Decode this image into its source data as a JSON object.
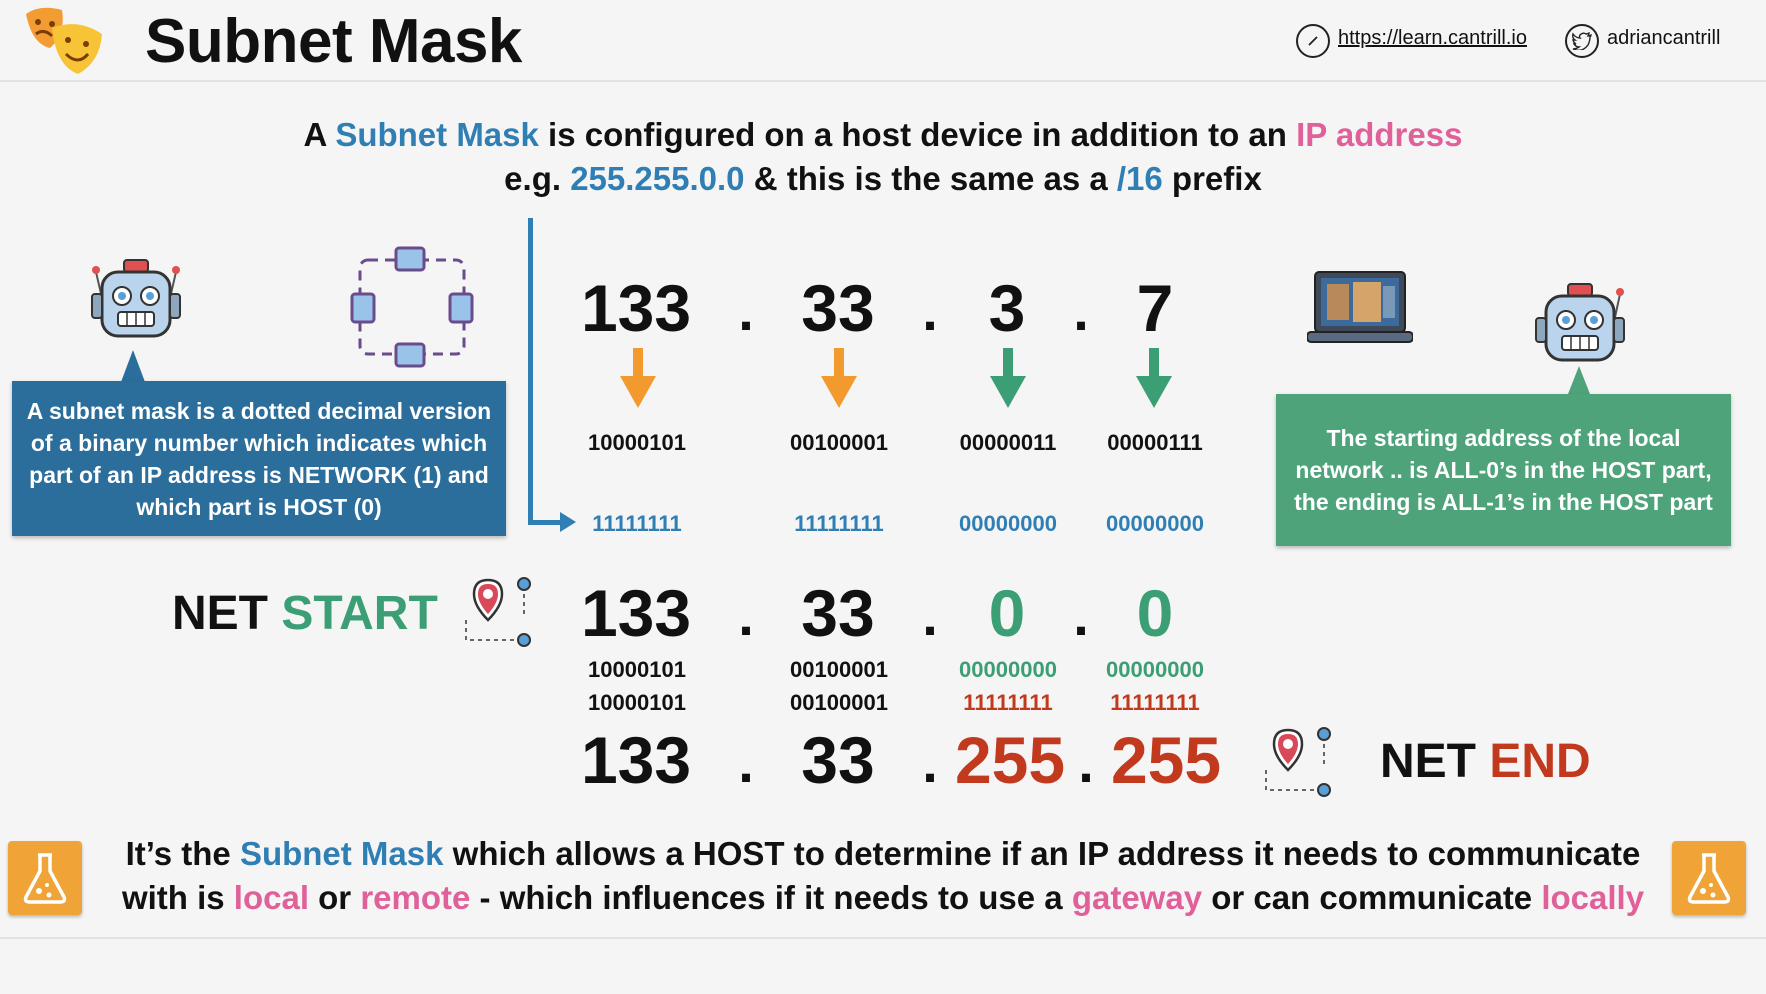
{
  "header": {
    "title": "Subnet Mask",
    "site_link": "https://learn.cantrill.io",
    "twitter_handle": "adriancantrill"
  },
  "headline": {
    "line1": {
      "p1": "A ",
      "p2": "Subnet Mask",
      "p3": " is configured on a host device in addition to an ",
      "p4": "IP address"
    },
    "line2": {
      "p1": "e.g. ",
      "p2": "255.255.0.0",
      "p3": " & this is the same as a ",
      "p4": "/16",
      "p5": " prefix"
    }
  },
  "left_callout": "A subnet mask is a dotted decimal version of a binary number which indicates which part of an IP address is NETWORK (1) and which part is HOST (0)",
  "right_callout": "The starting address of the local network .. is ALL-0’s in the HOST part, the ending is ALL-1’s in the HOST part",
  "ip": {
    "octets": [
      "133",
      "33",
      "3",
      "7"
    ],
    "binary": [
      "10000101",
      "00100001",
      "00000011",
      "00000111"
    ],
    "mask_binary": [
      "11111111",
      "11111111",
      "00000000",
      "00000000"
    ]
  },
  "net_start": {
    "label_a": "NET ",
    "label_b": "START",
    "octets": [
      "133",
      "33",
      "0",
      "0"
    ],
    "binary": [
      "10000101",
      "00100001",
      "00000000",
      "00000000"
    ]
  },
  "net_end": {
    "label_a": "NET ",
    "label_b": "END",
    "octets": [
      "133",
      "33",
      "255",
      "255"
    ],
    "binary": [
      "10000101",
      "00100001",
      "11111111",
      "11111111"
    ]
  },
  "dot": ".",
  "bottom": {
    "l1a": "It’s the ",
    "l1b": "Subnet Mask",
    "l1c": " which allows a HOST to determine if an IP address it needs to communicate",
    "l2a": "with is ",
    "l2b": "local",
    "l2c": " or ",
    "l2d": "remote",
    "l2e": " - which influences if it needs to use a ",
    "l2f": "gateway",
    "l2g": " or can communicate ",
    "l2h": "locally"
  },
  "colors": {
    "blue": "#2f7eb4",
    "pink": "#e0609a",
    "green": "#3c9e74",
    "red": "#c23a1e",
    "orange": "#f29a2e",
    "left_callout_bg": "#2b6e9c",
    "right_callout_bg": "#4fa37a"
  },
  "icons": [
    "masks-logo-icon",
    "compass-icon",
    "twitter-icon",
    "robot-icon",
    "network-loop-icon",
    "laptop-icon",
    "map-pin-icon",
    "flask-icon",
    "arrow-down-icon"
  ]
}
